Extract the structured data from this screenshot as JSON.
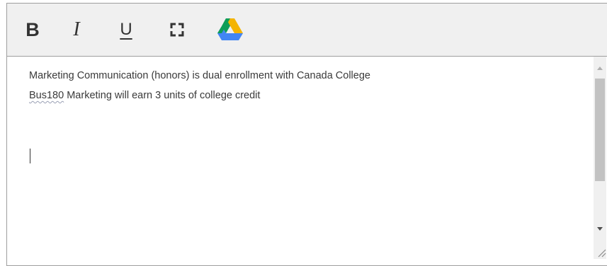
{
  "toolbar": {
    "bold_label": "B",
    "italic_label": "I",
    "underline_label": "U",
    "icons": [
      "fullscreen-icon",
      "google-drive-icon"
    ]
  },
  "editor": {
    "lines": [
      {
        "text": "Marketing Communication (honors) is dual enrollment with Canada College"
      },
      {
        "misspelled_word": "Bus180",
        "rest": " Marketing will earn 3 units of college credit"
      }
    ]
  },
  "colors": {
    "toolbar_bg": "#f0f0f0",
    "border": "#9e9e9e",
    "text": "#3a3a3a",
    "scroll_thumb": "#c2c2c2",
    "drive_green": "#0f9d58",
    "drive_yellow": "#f4b400",
    "drive_blue": "#4285f4"
  }
}
